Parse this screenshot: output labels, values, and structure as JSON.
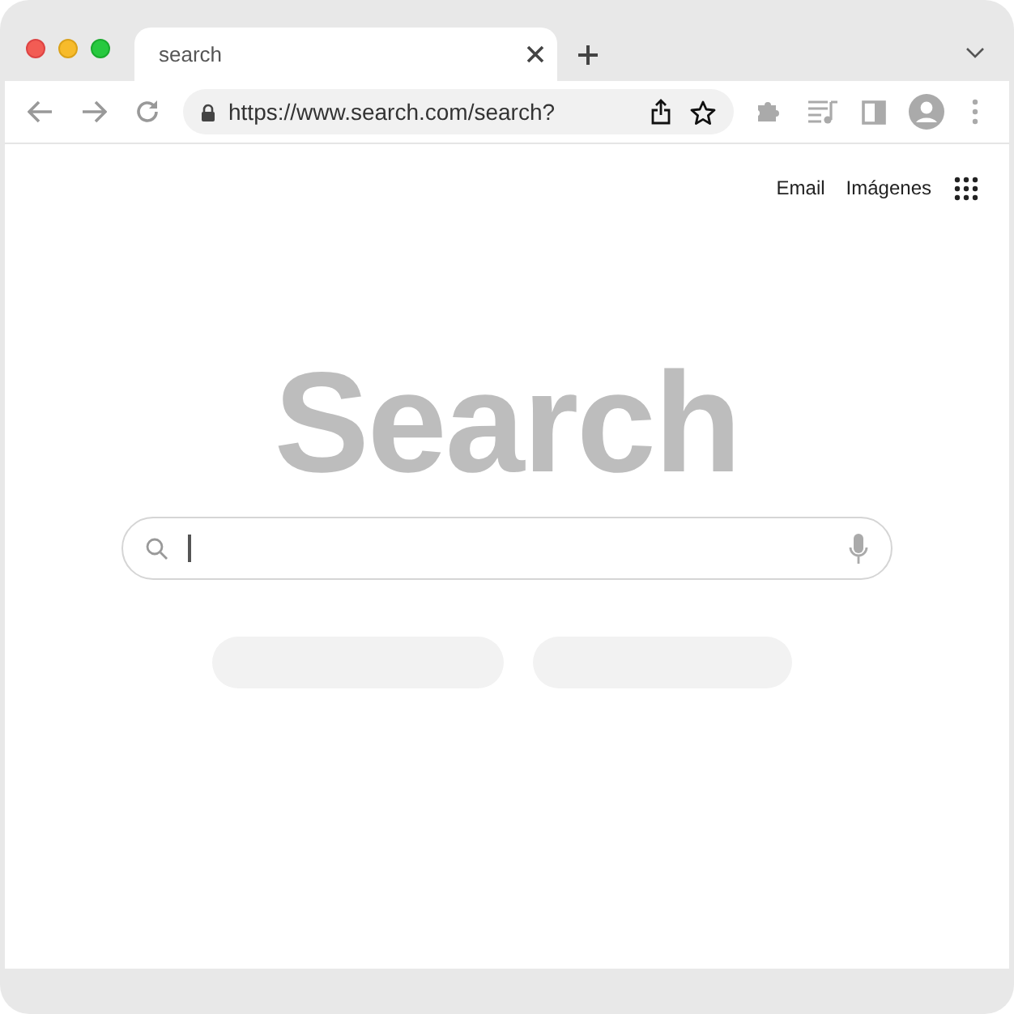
{
  "tabs": [
    {
      "title": "search",
      "selected": true
    }
  ],
  "address_bar": {
    "url": "https://www.search.com/search?"
  },
  "header_links": [
    "Email",
    "Imágenes"
  ],
  "logo": "Search",
  "search_field": {
    "focused": true
  },
  "buttons": [
    {
      "kind": "blank"
    },
    {
      "kind": "blank"
    }
  ]
}
